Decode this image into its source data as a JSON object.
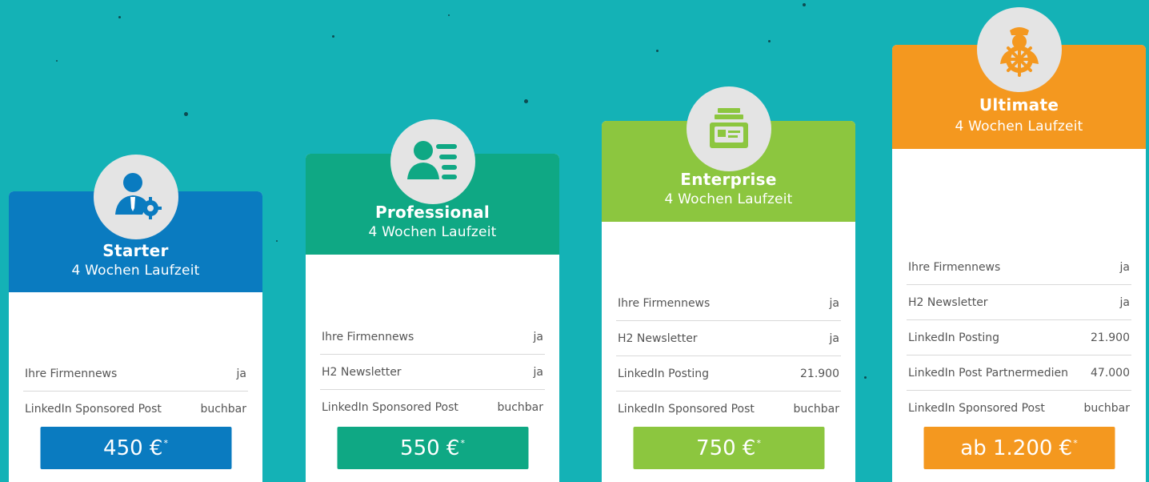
{
  "colors": {
    "background": "#14b2b6",
    "starter": "#0a7bc0",
    "professional": "#0fa884",
    "enterprise": "#8cc63f",
    "ultimate": "#f4981f",
    "icon_circle": "#e4e4e4"
  },
  "plans": [
    {
      "name": "Starter",
      "duration": "4 Wochen Laufzeit",
      "icon": "user-gear-icon",
      "features": [
        {
          "label": "Ihre Firmennews",
          "value": "ja"
        },
        {
          "label": "LinkedIn Sponsored Post",
          "value": "buchbar"
        }
      ],
      "price": "450 €",
      "price_mark": "*"
    },
    {
      "name": "Professional",
      "duration": "4 Wochen Laufzeit",
      "icon": "user-list-icon",
      "features": [
        {
          "label": "Ihre Firmennews",
          "value": "ja"
        },
        {
          "label": "H2 Newsletter",
          "value": "ja"
        },
        {
          "label": "LinkedIn Sponsored Post",
          "value": "buchbar"
        }
      ],
      "price": "550 €",
      "price_mark": "*"
    },
    {
      "name": "Enterprise",
      "duration": "4 Wochen Laufzeit",
      "icon": "newsletter-stack-icon",
      "features": [
        {
          "label": "Ihre Firmennews",
          "value": "ja"
        },
        {
          "label": "H2 Newsletter",
          "value": "ja"
        },
        {
          "label": "LinkedIn Posting",
          "value": "21.900"
        },
        {
          "label": "LinkedIn Sponsored Post",
          "value": "buchbar"
        }
      ],
      "price": "750 €",
      "price_mark": "*"
    },
    {
      "name": "Ultimate",
      "duration": "4 Wochen Laufzeit",
      "icon": "captain-wheel-icon",
      "features": [
        {
          "label": "Ihre Firmennews",
          "value": "ja"
        },
        {
          "label": "H2 Newsletter",
          "value": "ja"
        },
        {
          "label": "LinkedIn Posting",
          "value": "21.900"
        },
        {
          "label": "LinkedIn Post Partnermedien",
          "value": "47.000"
        },
        {
          "label": "LinkedIn Sponsored Post",
          "value": "buchbar"
        }
      ],
      "price": "ab 1.200 €",
      "price_mark": "*"
    }
  ]
}
